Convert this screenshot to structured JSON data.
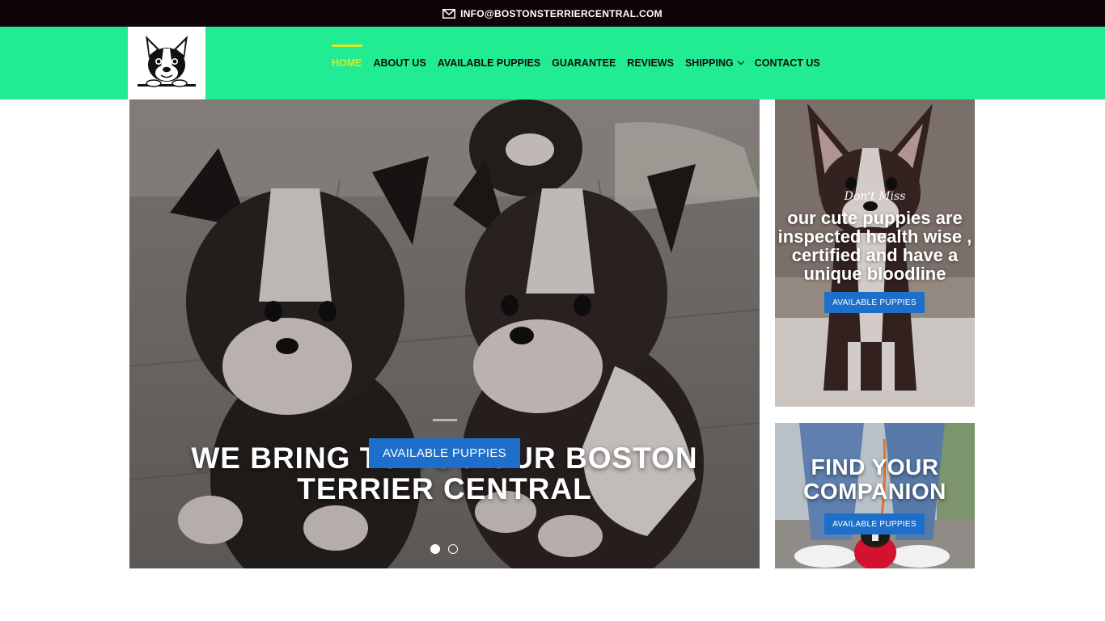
{
  "topbar": {
    "email": "INFO@BOSTONSTERRIERCENTRAL.COM",
    "icon": "envelope-icon"
  },
  "nav": {
    "items": [
      {
        "label": "HOME"
      },
      {
        "label": "ABOUT US"
      },
      {
        "label": "AVAILABLE PUPPIES"
      },
      {
        "label": "GUARANTEE"
      },
      {
        "label": "REVIEWS"
      },
      {
        "label": "SHIPPING"
      },
      {
        "label": "CONTACT US"
      }
    ],
    "active_color": "#d3e92b",
    "header_color": "#22ec93"
  },
  "hero": {
    "title": "WE BRING TO YOU OUR BOSTON TERRIER CENTRAL",
    "button": "AVAILABLE PUPPIES"
  },
  "promo1": {
    "kicker": "Don't Miss",
    "text": "our cute puppies are inspected health wise , certified and have a unique bloodline",
    "button": "AVAILABLE PUPPIES"
  },
  "promo2": {
    "title": "FIND YOUR COMPANION",
    "button": "AVAILABLE PUPPIES"
  },
  "colors": {
    "button_blue": "#1e6fc9",
    "topbar": "#0f0506"
  }
}
